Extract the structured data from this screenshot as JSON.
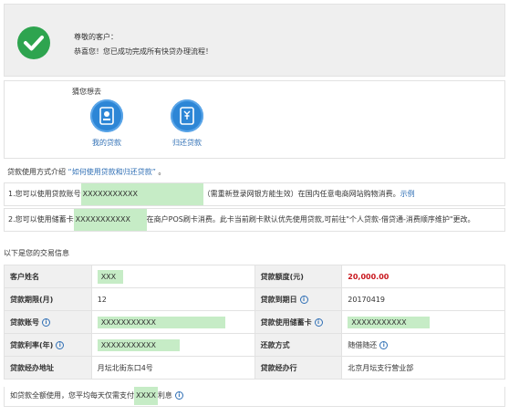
{
  "success": {
    "greeting": "尊敬的客户：",
    "message": "恭喜您！您已成功完成所有快贷办理流程！"
  },
  "guess": {
    "title": "猜您想去",
    "items": [
      {
        "label": "我的贷款",
        "icon": "my-loan-icon"
      },
      {
        "label": "归还贷款",
        "icon": "repay-loan-icon"
      }
    ]
  },
  "intro": {
    "prefix": "贷款使用方式介绍",
    "link": "“如何使用贷款和归还贷款”",
    "suffix": "。"
  },
  "notes": [
    {
      "prefix": "1.您可以使用贷款账号",
      "masked": "XXXXXXXXXXX",
      "suffix": "（需重新登录网银方能生效）在国内任意电商网站购物消费。",
      "link": "示例"
    },
    {
      "prefix": "2.您可以使用储蓄卡",
      "masked": "XXXXXXXXXXX",
      "suffix": "在商户POS刷卡消费。此卡当前刷卡默认优先使用贷款,可前往\"个人贷款-借贷通-消费顺序维护\"更改。"
    }
  ],
  "transaction": {
    "title": "以下是您的交易信息",
    "rows": [
      [
        {
          "key": "客户姓名",
          "value": "XXX",
          "masked": true
        },
        {
          "key": "贷款额度(元)",
          "value": "20,000.00",
          "red": true
        }
      ],
      [
        {
          "key": "贷款期限(月)",
          "value": "12"
        },
        {
          "key": "贷款到期日",
          "info": true,
          "value": "20170419"
        }
      ],
      [
        {
          "key": "贷款账号",
          "info": true,
          "value": "XXXXXXXXXXX",
          "masked": true
        },
        {
          "key": "贷款使用储蓄卡",
          "info": true,
          "value": "XXXXXXXXXXX",
          "masked": true
        }
      ],
      [
        {
          "key": "贷款利率(年)",
          "info": true,
          "value": "XXXXXXXXXXX",
          "masked": true
        },
        {
          "key": "还款方式",
          "value": "随借随还",
          "valueInfo": true
        }
      ],
      [
        {
          "key": "贷款经办地址",
          "value": "月坛北街东口4号"
        },
        {
          "key": "贷款经办行",
          "value": "北京月坛支行营业部"
        }
      ]
    ],
    "footer": {
      "prefix": "如贷款全额使用，您平均每天仅需支付",
      "masked": "XXXX",
      "suffix": "利息"
    }
  },
  "colors": {
    "success": "#2ea44f",
    "accent": "#2d86d6",
    "link": "#2f6fb5",
    "amount": "#c8161d",
    "mask": "#c6ecc6"
  }
}
